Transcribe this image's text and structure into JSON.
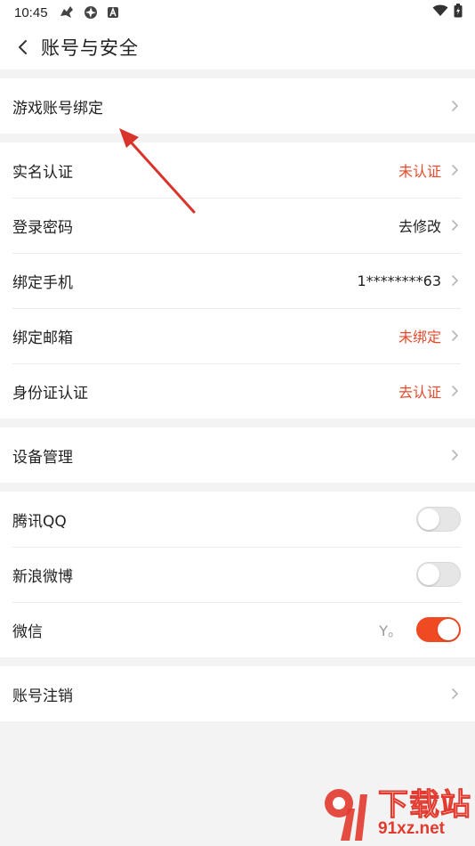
{
  "status_bar": {
    "time": "10:45"
  },
  "header": {
    "title": "账号与安全"
  },
  "groups": {
    "game": {
      "label": "游戏账号绑定"
    },
    "verify": {
      "items": [
        {
          "label": "实名认证",
          "value": "未认证",
          "color": "#e8492b"
        },
        {
          "label": "登录密码",
          "value": "去修改",
          "color": "#222222"
        },
        {
          "label": "绑定手机",
          "value": "1********63",
          "color": "#222222"
        },
        {
          "label": "绑定邮箱",
          "value": "未绑定",
          "color": "#e8492b"
        },
        {
          "label": "身份证认证",
          "value": "去认证",
          "color": "#e8492b"
        }
      ]
    },
    "device": {
      "label": "设备管理"
    },
    "social": {
      "items": [
        {
          "label": "腾讯QQ",
          "on": false
        },
        {
          "label": "新浪微博",
          "on": false
        },
        {
          "label": "微信",
          "hint": "Y。",
          "on": true
        }
      ]
    },
    "cancel": {
      "label": "账号注销"
    }
  },
  "colors": {
    "accent": "#f04a23",
    "warning_text": "#e8492b",
    "annotation_arrow": "#d9342b"
  },
  "watermark": {
    "big": "下载站",
    "small": "91xz.net"
  }
}
